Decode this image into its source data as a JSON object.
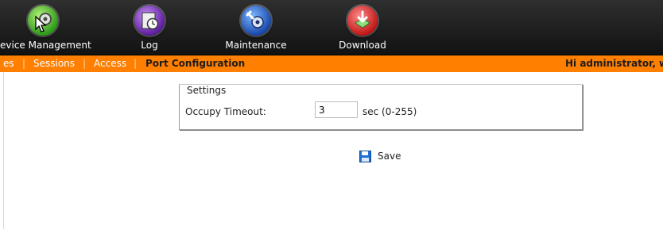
{
  "nav": {
    "items": [
      {
        "label": "evice Management",
        "icon": "device-management-icon"
      },
      {
        "label": "Log",
        "icon": "log-clock-icon"
      },
      {
        "label": "Maintenance",
        "icon": "maintenance-icon"
      },
      {
        "label": "Download",
        "icon": "download-icon"
      }
    ]
  },
  "subnav": {
    "items": [
      "es",
      "Sessions",
      "Access",
      "Port Configuration"
    ],
    "active_index": 3,
    "greeting": "Hi administrator, w"
  },
  "settings": {
    "legend": "Settings",
    "occupy_timeout_label": "Occupy Timeout:",
    "occupy_timeout_value": "3",
    "unit": "sec (0-255)"
  },
  "actions": {
    "save_label": "Save"
  },
  "colors": {
    "accent": "#ff7f00",
    "nav_bg": "#1e1e1e"
  }
}
